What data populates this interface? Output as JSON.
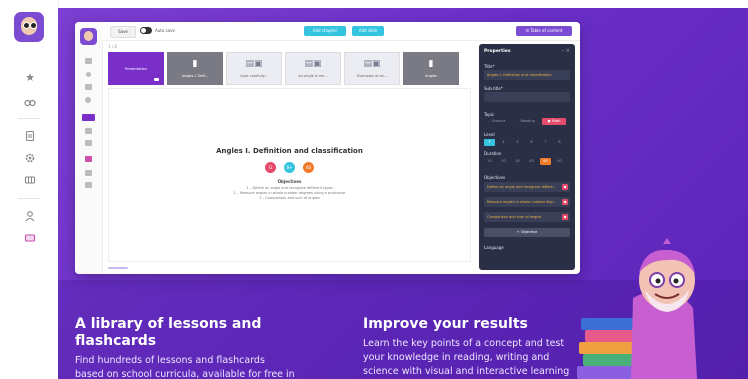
{
  "rail": {
    "icons": [
      "star-icon",
      "binoculars-icon",
      "document-icon",
      "gear-icon",
      "grid-icon",
      "user-icon",
      "cards-icon"
    ]
  },
  "toolbar": {
    "save_label": "Save",
    "autosave_label": "Auto save",
    "add_chapter_label": "Add chapter",
    "add_slide_label": "Add slide",
    "toc_label": "☰ Table of content"
  },
  "zoom_label": "1 / 8",
  "slides": [
    {
      "label": "Presentation",
      "state": "active"
    },
    {
      "label": "Angles I. Defi...",
      "state": "dark"
    },
    {
      "label": "Look carefully...",
      "state": "normal"
    },
    {
      "label": "An angle is me...",
      "state": "normal"
    },
    {
      "label": "Examples of an...",
      "state": "normal"
    },
    {
      "label": "Angles",
      "state": "dark"
    }
  ],
  "slide": {
    "title": "Angles I. Definition and classification",
    "badges": [
      {
        "text": "G",
        "color": "#e34b6a"
      },
      {
        "text": "B+",
        "color": "#35c4e0"
      },
      {
        "text": "60",
        "color": "#f07a28"
      }
    ],
    "objectives_heading": "Objectives",
    "objectives": [
      "1 – Define an angle and recognize different types",
      "2 – Measure angles in whole number degrees using a protractor",
      "3 – Comparison and sum of angles"
    ]
  },
  "properties": {
    "title": "Properties",
    "title_label": "Title*",
    "title_value": "Angles I. Definition and classification",
    "subtitle_label": "Sub-title*",
    "topic_label": "Topic",
    "topics": [
      {
        "label": "◦ Science",
        "state": "off"
      },
      {
        "label": "◦ Reading",
        "state": "off"
      },
      {
        "label": "● Math",
        "state": "on-red"
      }
    ],
    "level_label": "Level",
    "levels": [
      {
        "label": "3",
        "state": "on-cyan"
      },
      {
        "label": "4",
        "state": "off"
      },
      {
        "label": "5",
        "state": "off"
      },
      {
        "label": "6",
        "state": "off"
      },
      {
        "label": "7",
        "state": "off"
      },
      {
        "label": "8",
        "state": "off"
      }
    ],
    "duration_label": "Duration",
    "durations": [
      {
        "label": "15",
        "state": "off"
      },
      {
        "label": "20",
        "state": "off"
      },
      {
        "label": "30",
        "state": "off"
      },
      {
        "label": "45",
        "state": "off"
      },
      {
        "label": "60",
        "state": "on-orange"
      },
      {
        "label": "90",
        "state": "off"
      }
    ],
    "objectives_label": "Objectives",
    "objectives": [
      "Define an angle and recognize differe...",
      "Measure angles in whole number deg...",
      "Comparison and sum of angles"
    ],
    "add_objective_label": "+ Objective",
    "language_label": "Language"
  },
  "features": [
    {
      "title_lines": [
        "A library of lessons and",
        "flashcards"
      ],
      "body_lines": [
        "Find hundreds of lessons and flashcards",
        "based on school curricula, available for free in"
      ]
    },
    {
      "title_lines": [
        "Improve your results"
      ],
      "body_lines": [
        "Learn the key points of a concept and test",
        "your knowledge in reading, writing and",
        "science with visual and interactive learning"
      ]
    }
  ],
  "colors": {
    "brand_purple": "#7b2fc9",
    "accent_cyan": "#35c4e0",
    "accent_orange": "#f07a28",
    "accent_red": "#e34b6a",
    "panel_dark": "#2b2f45"
  }
}
